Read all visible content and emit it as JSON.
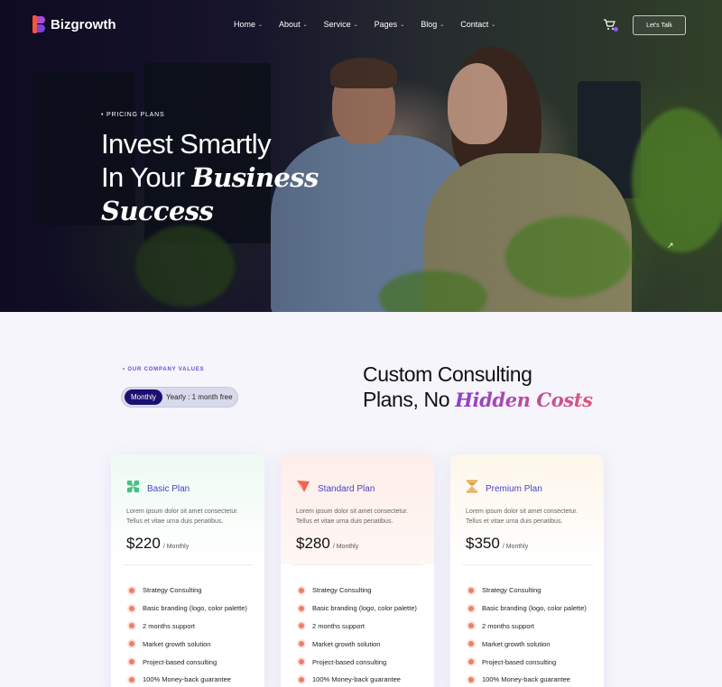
{
  "brand": {
    "name": "Bizgrowth"
  },
  "nav": {
    "items": [
      {
        "label": "Home"
      },
      {
        "label": "About"
      },
      {
        "label": "Service"
      },
      {
        "label": "Pages"
      },
      {
        "label": "Blog"
      },
      {
        "label": "Contact"
      }
    ],
    "cta_label": "Let's Talk",
    "cart_icon": "cart-icon"
  },
  "hero": {
    "eyebrow": "• PRICING PLANS",
    "line1": "Invest Smartly",
    "line2_plain": "In Your ",
    "line2_italic": "Business",
    "line3_italic": "Success"
  },
  "pricing": {
    "values_label": "• OUR COMPANY VALUES",
    "toggle": {
      "active": "Monthly",
      "inactive": "Yearly : 1 month free"
    },
    "title_line1": "Custom Consulting",
    "title_line2_plain": "Plans, No ",
    "title_line2_italic": "Hidden Costs",
    "plans": [
      {
        "name": "Basic Plan",
        "icon": "clover-icon",
        "icon_color": "#3fbf7f",
        "description": "Lorem ipsum dolor sit amet consectetur. Tellus et vitae urna duis penatibus.",
        "price": "$220",
        "period": "/ Monthly",
        "features": [
          "Strategy Consulting",
          "Basic branding (logo, color palette)",
          "2 months support",
          "Market growth solution",
          "Project-based consulting",
          "100% Money-back guarantee"
        ]
      },
      {
        "name": "Standard Plan",
        "icon": "paper-plane-icon",
        "icon_color": "#f0664a",
        "description": "Lorem ipsum dolor sit amet consectetur. Tellus et vitae urna duis penatibus.",
        "price": "$280",
        "period": "/ Monthly",
        "features": [
          "Strategy Consulting",
          "Basic branding (logo, color palette)",
          "2 months support",
          "Market growth solution",
          "Project-based consulting",
          "100% Money-back guarantee"
        ]
      },
      {
        "name": "Premium Plan",
        "icon": "hourglass-icon",
        "icon_color": "#e0a33a",
        "description": "Lorem ipsum dolor sit amet consectetur. Tellus et vitae urna duis penatibus.",
        "price": "$350",
        "period": "/ Monthly",
        "features": [
          "Strategy Consulting",
          "Basic branding (logo, color palette)",
          "2 months support",
          "Market growth solution",
          "Project-based consulting",
          "100% Money-back guarantee"
        ]
      }
    ]
  },
  "colors": {
    "accent": "#4a3fc8",
    "dark_navy": "#1a1070",
    "bullet": "#e9806a"
  }
}
